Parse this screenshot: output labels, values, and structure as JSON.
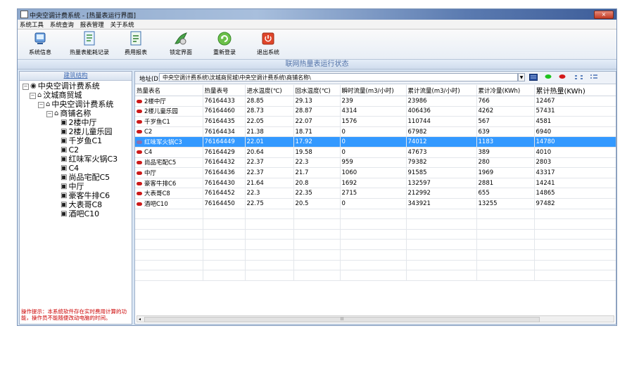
{
  "window": {
    "title": "中央空调计费系统 - [热量表运行界面]",
    "close": "×"
  },
  "menu": [
    "系统工具",
    "系统查询",
    "报表管理",
    "关于系统"
  ],
  "toolbar": {
    "sys_info": "系统信息",
    "heat_records": "热量表能耗记录",
    "cost_report": "费用报表",
    "lock": "锁定界面",
    "relogin": "重新登录",
    "exit": "退出系统"
  },
  "banner": "联网热量表运行状态",
  "left": {
    "header": "建筑结构",
    "tree": {
      "root": "中央空调计费系统",
      "building": "汶城商贸城",
      "system": "中央空调计费系统",
      "group": "商铺名称",
      "shops": [
        "2楼中厅",
        "2楼儿童乐园",
        "千岁鱼C1",
        "C2",
        "红味军火锅C3",
        "C4",
        "尚品宅配C5",
        "中厅",
        "豪客牛排C6",
        "大表哥C8",
        "酒吧C10"
      ]
    },
    "hint": "操作提示：本系统软件存在实时费用计算的功能，操作员不能随便改动电脑的时间。"
  },
  "address": {
    "label": "地址(D)",
    "path": "中央空调计费系统\\汶城商贸城\\中央空调计费系统\\商铺名称\\"
  },
  "table": {
    "columns": [
      "热量表名",
      "热量表号",
      "进水温度(℃)",
      "回水温度(℃)",
      "瞬时流量(m3/小时)",
      "累计流量(m3/小时)",
      "累计冷量(KWh)",
      "累计热量(KWh)"
    ],
    "rows": [
      [
        "2楼中厅",
        "76164433",
        "28.85",
        "29.13",
        "239",
        "23986",
        "766",
        "12467"
      ],
      [
        "2楼儿童乐园",
        "76164460",
        "28.73",
        "28.87",
        "4314",
        "406436",
        "4262",
        "57431"
      ],
      [
        "千岁鱼C1",
        "76164435",
        "22.05",
        "22.07",
        "1576",
        "110744",
        "567",
        "4581"
      ],
      [
        "C2",
        "76164434",
        "21.38",
        "18.71",
        "0",
        "67982",
        "639",
        "6940"
      ],
      [
        "红味军火锅C3",
        "76164449",
        "22.01",
        "17.92",
        "0",
        "74012",
        "1183",
        "14780"
      ],
      [
        "C4",
        "76164429",
        "20.64",
        "19.58",
        "0",
        "47673",
        "389",
        "4010"
      ],
      [
        "尚品宅配C5",
        "76164432",
        "22.37",
        "22.3",
        "959",
        "79382",
        "280",
        "2803"
      ],
      [
        "中厅",
        "76164436",
        "22.37",
        "21.7",
        "1060",
        "91585",
        "1969",
        "43317"
      ],
      [
        "豪客牛排C6",
        "76164430",
        "21.64",
        "20.8",
        "1692",
        "132597",
        "2881",
        "14241"
      ],
      [
        "大表哥C8",
        "76164452",
        "22.3",
        "22.35",
        "2715",
        "212992",
        "655",
        "14865"
      ],
      [
        "酒吧C10",
        "76164450",
        "22.75",
        "20.5",
        "0",
        "343921",
        "13255",
        "97482"
      ]
    ],
    "selected_row": 4
  },
  "scrollbar": {
    "thumb": "III"
  },
  "colors": {
    "selected": "#3399ff",
    "status_dot": "#cc1a1a",
    "hint": "#cc0000",
    "banner": "#5272a8"
  }
}
